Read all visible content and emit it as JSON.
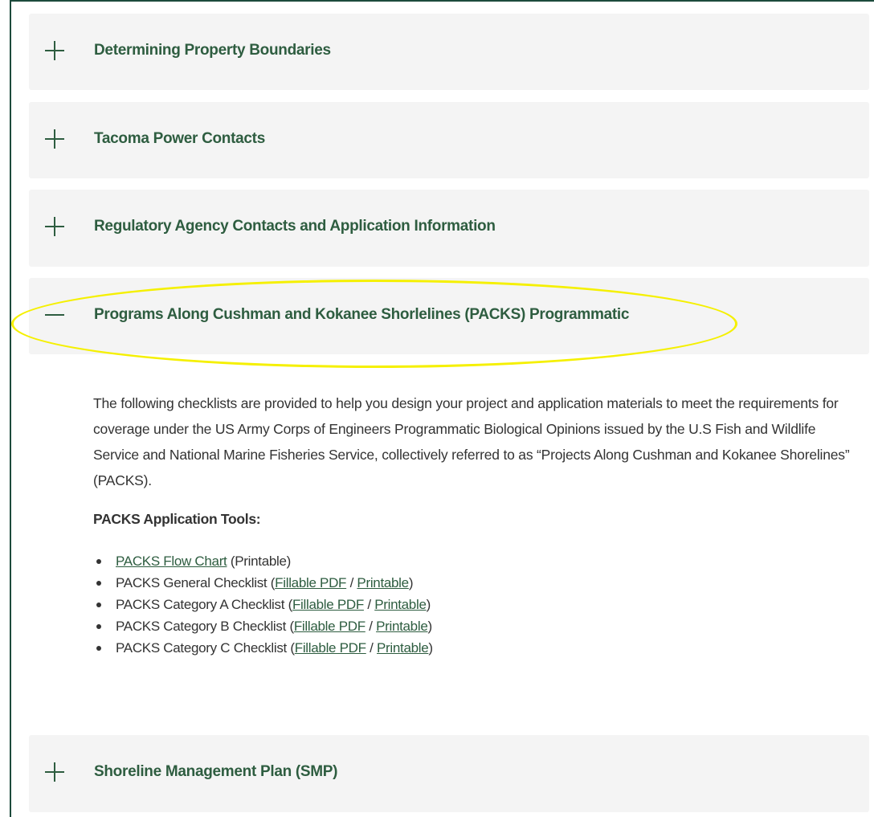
{
  "accordion": {
    "items": [
      {
        "title": "Determining Property Boundaries",
        "state": "collapsed",
        "icon": "plus-icon"
      },
      {
        "title": "Tacoma Power Contacts",
        "state": "collapsed",
        "icon": "plus-icon"
      },
      {
        "title": "Regulatory Agency Contacts and Application Information",
        "state": "collapsed",
        "icon": "plus-icon"
      },
      {
        "title": "Programs Along Cushman and Kokanee Shorlelines (PACKS) Programmatic",
        "state": "expanded",
        "icon": "minus-icon"
      },
      {
        "title": "Shoreline Management Plan (SMP)",
        "state": "collapsed",
        "icon": "plus-icon"
      }
    ]
  },
  "packs_panel": {
    "intro": "The following checklists are provided to help you design your project and application materials to meet the requirements for coverage under the US Army Corps of Engineers Programmatic Biological Opinions issued by the U.S Fish and Wildlife Service and National Marine Fisheries Service, collectively referred to as “Projects Along Cushman and Kokanee Shorelines” (PACKS).",
    "tools_heading": "PACKS Application Tools:",
    "tools": [
      {
        "prefix": "",
        "link": "PACKS Flow Chart",
        "suffix": " (Printable)"
      },
      {
        "prefix": "PACKS General Checklist (",
        "link1": "Fillable PDF",
        "sep": " / ",
        "link2": "Printable",
        "suffix": ")"
      },
      {
        "prefix": "PACKS Category A Checklist (",
        "link1": "Fillable PDF",
        "sep": " / ",
        "link2": "Printable",
        "suffix": ")"
      },
      {
        "prefix": "PACKS Category B Checklist (",
        "link1": "Fillable PDF",
        "sep": " / ",
        "link2": "Printable",
        "suffix": ")"
      },
      {
        "prefix": "PACKS Category C Checklist (",
        "link1": "Fillable PDF",
        "sep": " / ",
        "link2": "Printable",
        "suffix": ")"
      }
    ]
  },
  "colors": {
    "accent_green": "#2e5d40",
    "panel_bg": "#f4f4f4",
    "highlight_yellow": "#f5f000",
    "body_text": "#333333"
  }
}
